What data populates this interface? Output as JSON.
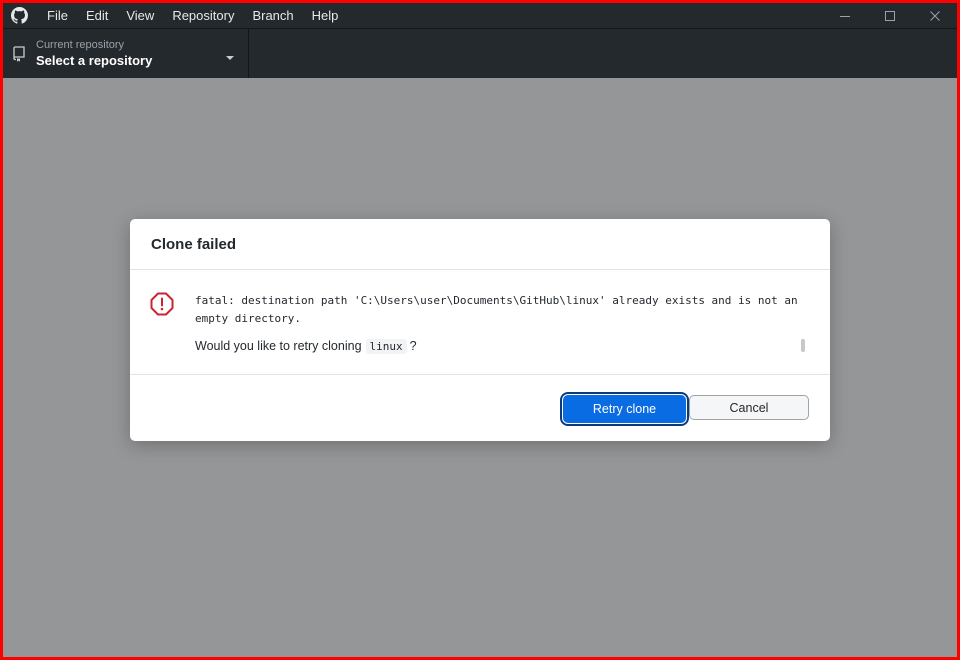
{
  "titlebar": {
    "app_icon": "github-logo-icon",
    "menu": [
      "File",
      "Edit",
      "View",
      "Repository",
      "Branch",
      "Help"
    ],
    "window_controls": [
      "minimize-icon",
      "maximize-icon",
      "close-icon"
    ]
  },
  "toolbar": {
    "repo_picker": {
      "icon": "repo-icon",
      "label": "Current repository",
      "value": "Select a repository",
      "caret_icon": "caret-down-icon"
    }
  },
  "dialog": {
    "title": "Clone failed",
    "icon": "error-octagon-icon",
    "error_message": "fatal: destination path 'C:\\Users\\user\\Documents\\GitHub\\linux' already exists and is not an empty directory.",
    "question_prefix": "Would you like to retry cloning",
    "question_repo": "linux",
    "question_suffix": "?",
    "retry_label": "Retry clone",
    "cancel_label": "Cancel"
  },
  "colors": {
    "titlebar": "#24292e",
    "overlay": "#959698",
    "primary_button": "#0a6ce3",
    "error": "#cb2431"
  }
}
